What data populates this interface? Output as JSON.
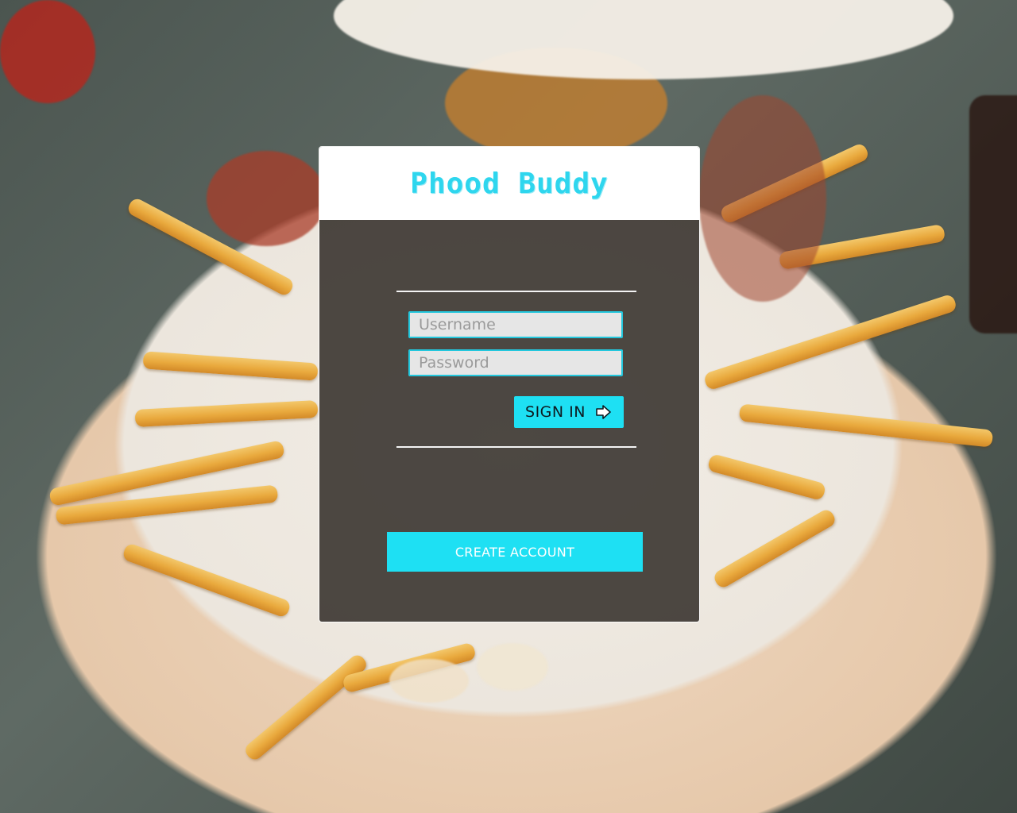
{
  "app": {
    "title": "Phood Buddy"
  },
  "login": {
    "username_placeholder": "Username",
    "username_value": "",
    "password_placeholder": "Password",
    "password_value": "",
    "sign_in_label": "SIGN IN",
    "sign_in_icon": "arrow-right-outline-icon",
    "create_account_label": "CREATE ACCOUNT"
  },
  "theme": {
    "accent": "#1ee0f3",
    "brand_text": "#2ed6ee",
    "panel_overlay": "rgba(35,30,25,0.80)"
  },
  "background": {
    "image_subject": "plate of loaded fries with bacon, cheese and onions"
  }
}
